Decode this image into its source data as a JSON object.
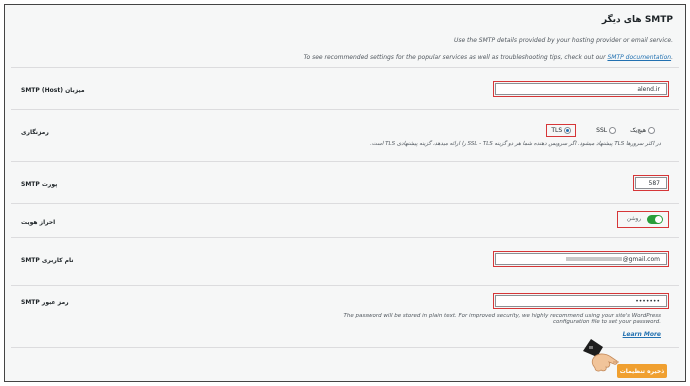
{
  "header": {
    "title": "SMTP های دیگر",
    "desc1": "Use the SMTP details provided by your hosting provider or email service.",
    "desc2_prefix": "To see recommended settings for the popular services as well as troubleshooting tips, check out our",
    "desc2_link": "SMTP documentation",
    "desc2_suffix": "."
  },
  "host": {
    "label": "میزبان (Host) SMTP",
    "value": "alend.ir"
  },
  "encryption": {
    "label": "رمزنگاری",
    "options": [
      "هیچ‌یک",
      "SSL",
      "TLS"
    ],
    "selected": "TLS",
    "note": "در اکثر سرورها TLS پیشنهاد میشود. اگر سرویس دهنده شما هر دو گزینه SSL - TLS را ارائه میدهد، گزینه پیشنهادی TLS است."
  },
  "port": {
    "label": "پورت SMTP",
    "value": "587"
  },
  "auth": {
    "label": "احراز هویت",
    "toggle_label": "روشن",
    "enabled": true
  },
  "username": {
    "label": "نام کاربری SMTP",
    "value": "@gmail.com"
  },
  "password": {
    "label": "رمز عبور SMTP",
    "value": "•••••••",
    "note": "The password will be stored in plain text. For improved security, we highly recommend using your site's WordPress configuration file to set your password.",
    "learn_more": "Learn More"
  },
  "save_button": "ذخیره تنظیمات",
  "colors": {
    "highlight": "#d63638",
    "accent": "#2271b1",
    "toggle": "#2a9d3a",
    "button": "#f0a030"
  }
}
